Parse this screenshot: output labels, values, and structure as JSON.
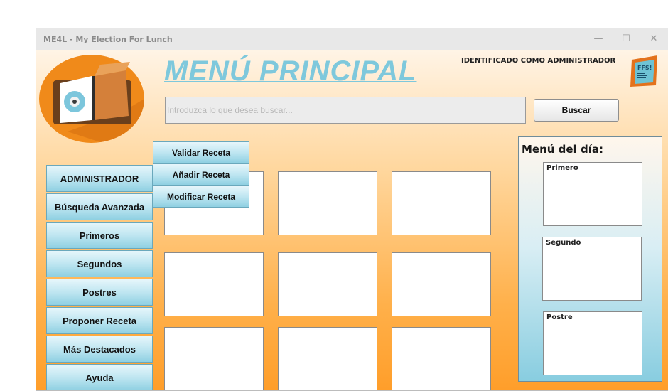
{
  "window": {
    "title": "ME4L - My Election For Lunch",
    "controls": {
      "minimize": "—",
      "maximize": "☐",
      "close": "✕"
    }
  },
  "header": {
    "heading": "MENÚ PRINCIPAL",
    "identified_as": "IDENTIFICADO COMO ADMINISTRADOR",
    "ffs_logo_text": "FFS!"
  },
  "search": {
    "placeholder": "Introduzca lo que desea buscar...",
    "value": "",
    "button_label": "Buscar"
  },
  "sidebar": {
    "items": [
      {
        "label": "ADMINISTRADOR"
      },
      {
        "label": "Búsqueda Avanzada"
      },
      {
        "label": "Primeros"
      },
      {
        "label": "Segundos"
      },
      {
        "label": "Postres"
      },
      {
        "label": "Proponer Receta"
      },
      {
        "label": "Más Destacados"
      },
      {
        "label": "Ayuda"
      }
    ]
  },
  "admin_menu": {
    "items": [
      {
        "label": "Validar Receta"
      },
      {
        "label": "Añadir Receta"
      },
      {
        "label": "Modificar Receta"
      }
    ]
  },
  "menu_del_dia": {
    "title": "Menú del día:",
    "primero": "Primero",
    "segundo": "Segundo",
    "postre": "Postre"
  },
  "colors": {
    "heading": "#7ec8dc",
    "button_gradient_end": "#8fd0e2",
    "background_top": "#fff4e6",
    "background_bottom": "#ff9e2a",
    "logo_circle": "#f08a1a"
  }
}
